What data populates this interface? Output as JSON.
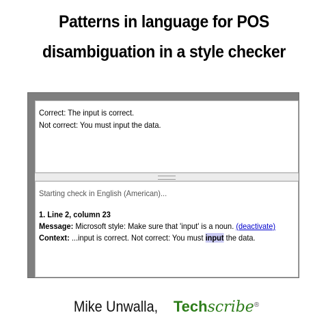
{
  "title": {
    "line1": "Patterns in language for POS",
    "line2": "disambiguation in a style checker"
  },
  "editor": {
    "line1": "Correct: The input is correct.",
    "line2": "Not correct: You must input the data."
  },
  "results": {
    "status": "Starting check in English (American)...",
    "item_heading": "1. Line 2, column 23",
    "message_label": "Message:",
    "message_text": " Microsoft style: Make sure that 'input' is a noun. ",
    "deactivate_link": "(deactivate)",
    "context_label": "Context:",
    "context_before": " ...input is correct. Not correct: You must ",
    "context_highlight": "input",
    "context_after": " the data."
  },
  "footer": {
    "author": "Mike Unwalla,",
    "brand_prefix": "Tech",
    "brand_suffix": "scribe",
    "brand_mark": "®"
  },
  "colors": {
    "brand": "#2d7d1a",
    "link": "#0000cc",
    "highlight": "#c9c9f2"
  }
}
